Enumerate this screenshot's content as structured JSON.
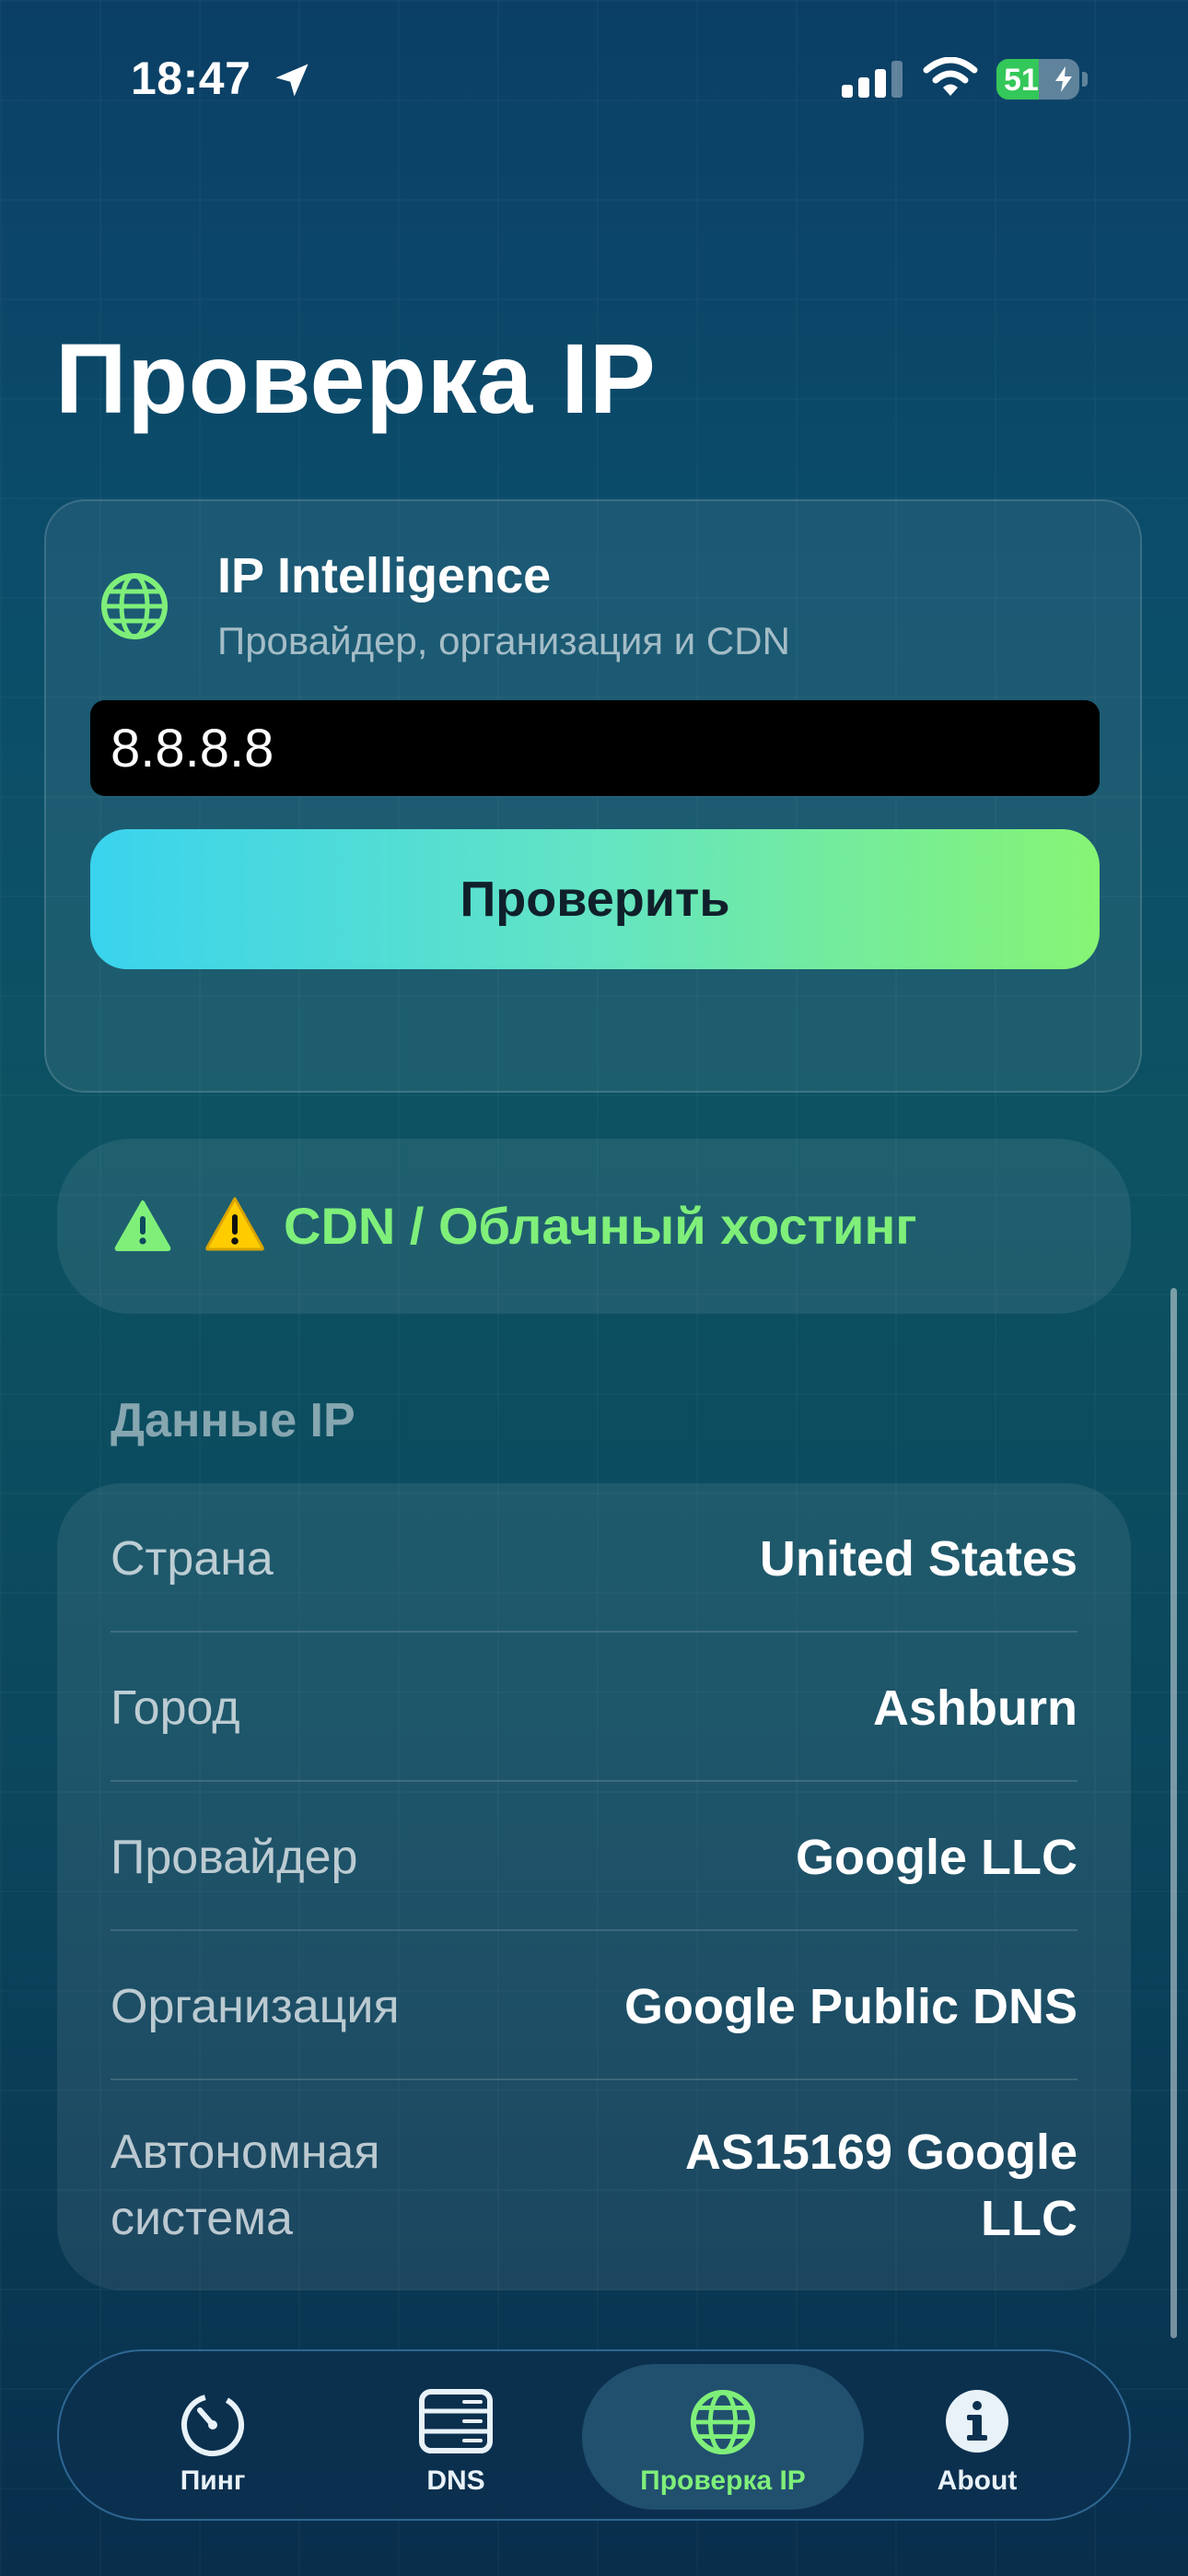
{
  "status_bar": {
    "time": "18:47",
    "battery_level": "51",
    "battery_fraction": 0.51
  },
  "page": {
    "title": "Проверка IP"
  },
  "lookup_card": {
    "title": "IP Intelligence",
    "subtitle": "Провайдер, организация и CDN",
    "ip_value": "8.8.8.8",
    "check_button_label": "Проверить"
  },
  "warning": {
    "text": "⚠️ CDN / Облачный хостинг",
    "color": "#7fef7a"
  },
  "ip_details": {
    "section_title": "Данные IP",
    "rows": [
      {
        "label": "Страна",
        "value": "United States"
      },
      {
        "label": "Город",
        "value": "Ashburn"
      },
      {
        "label": "Провайдер",
        "value": "Google LLC"
      },
      {
        "label": "Организация",
        "value": "Google Public DNS"
      },
      {
        "label": "Автономная система",
        "value": "AS15169 Google LLC"
      }
    ]
  },
  "tab_bar": {
    "tabs": [
      {
        "label": "Пинг",
        "icon": "stopwatch-icon",
        "active": false
      },
      {
        "label": "DNS",
        "icon": "server-icon",
        "active": false
      },
      {
        "label": "Проверка IP",
        "icon": "globe-icon",
        "active": true
      },
      {
        "label": "About",
        "icon": "info-icon",
        "active": false
      }
    ],
    "active_color": "#7fef7a"
  },
  "colors": {
    "accent_gradient_start": "#3ad3ee",
    "accent_gradient_end": "#86f474",
    "background": "#0b4d6a"
  }
}
